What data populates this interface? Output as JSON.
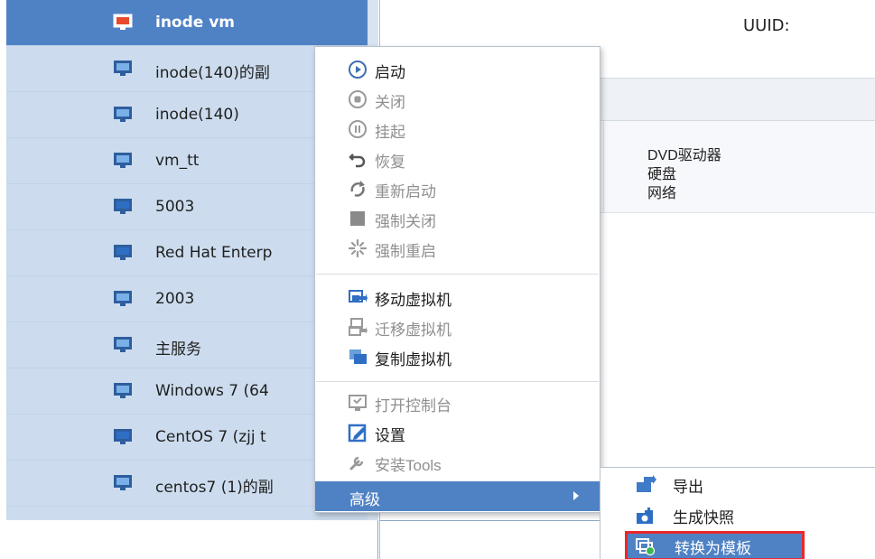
{
  "vm_list": {
    "items": [
      {
        "label": "inode vm",
        "selected": true
      },
      {
        "label": "inode(140)的副"
      },
      {
        "label": "inode(140)"
      },
      {
        "label": "vm_tt"
      },
      {
        "label": "5003"
      },
      {
        "label": "Red Hat Enterp"
      },
      {
        "label": "2003"
      },
      {
        "label": "主服务"
      },
      {
        "label": "Windows 7 (64"
      },
      {
        "label": "CentOS 7 (zjj t"
      },
      {
        "label": "centos7 (1)的副"
      }
    ]
  },
  "details": {
    "uuid_label": "UUID:",
    "hardware": [
      "DVD驱动器",
      "硬盘",
      "网络"
    ]
  },
  "context_menu": {
    "items": [
      {
        "label": "启动",
        "icon": "play-circle-icon",
        "enabled": true
      },
      {
        "label": "关闭",
        "icon": "stop-circle-icon",
        "enabled": false
      },
      {
        "label": "挂起",
        "icon": "pause-circle-icon",
        "enabled": false
      },
      {
        "label": "恢复",
        "icon": "undo-icon",
        "enabled": false
      },
      {
        "label": "重新启动",
        "icon": "restart-icon",
        "enabled": false
      },
      {
        "label": "强制关闭",
        "icon": "force-stop-icon",
        "enabled": false
      },
      {
        "label": "强制重启",
        "icon": "force-restart-icon",
        "enabled": false
      },
      {
        "label": "移动虚拟机",
        "icon": "move-vm-icon",
        "enabled": true
      },
      {
        "label": "迁移虚拟机",
        "icon": "migrate-vm-icon",
        "enabled": false
      },
      {
        "label": "复制虚拟机",
        "icon": "copy-vm-icon",
        "enabled": true
      },
      {
        "label": "打开控制台",
        "icon": "console-icon",
        "enabled": false
      },
      {
        "label": "设置",
        "icon": "settings-edit-icon",
        "enabled": true
      },
      {
        "label": "安装Tools",
        "icon": "install-tools-icon",
        "enabled": false
      },
      {
        "label": "高级",
        "icon": "submenu-arrow-icon",
        "enabled": true,
        "active": true
      }
    ]
  },
  "sub_menu": {
    "items": [
      {
        "label": "导出",
        "icon": "export-icon"
      },
      {
        "label": "生成快照",
        "icon": "snapshot-icon"
      },
      {
        "label": "转换为模板",
        "icon": "convert-template-icon",
        "highlighted": true
      }
    ]
  },
  "colors": {
    "list_bg": "#ccdcee",
    "selection_blue": "#4f82c4",
    "highlight_border": "#e8282c"
  }
}
